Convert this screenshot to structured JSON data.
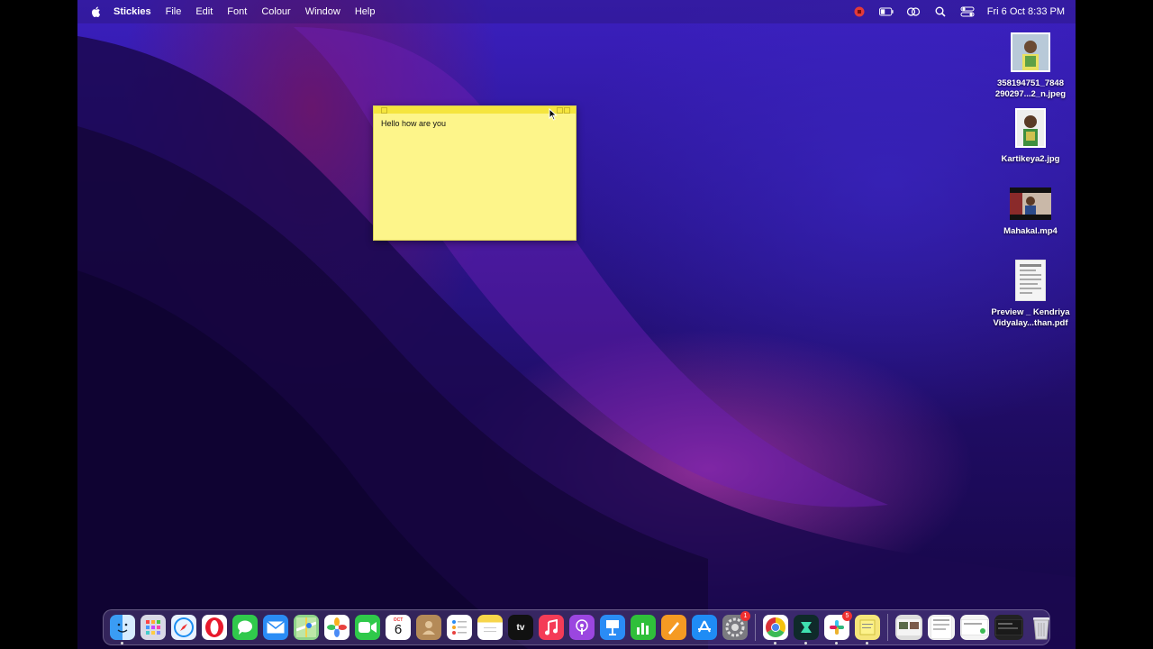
{
  "menubar": {
    "app_name": "Stickies",
    "menus": [
      "File",
      "Edit",
      "Font",
      "Colour",
      "Window",
      "Help"
    ],
    "clock": "Fri 6 Oct  8:33 PM"
  },
  "sticky": {
    "text": "Hello how are you",
    "color": "#fdf58a"
  },
  "desktop_icons": [
    {
      "name_line1": "358194751_7848",
      "name_line2": "290297...2_n.jpeg",
      "kind": "photo"
    },
    {
      "name_line1": "Kartikeya2.jpg",
      "name_line2": "",
      "kind": "photo"
    },
    {
      "name_line1": "Mahakal.mp4",
      "name_line2": "",
      "kind": "video"
    },
    {
      "name_line1": "Preview _ Kendriya",
      "name_line2": "Vidyalay...than.pdf",
      "kind": "pdf"
    }
  ],
  "dock": {
    "calendar_month": "OCT",
    "calendar_day": "6",
    "settings_badge": "1",
    "slack_badge": "5",
    "apps": [
      "finder-icon",
      "launchpad-icon",
      "safari-icon",
      "opera-icon",
      "messages-icon",
      "mail-icon",
      "maps-icon",
      "photos-icon",
      "facetime-icon",
      "calendar-icon",
      "contacts-icon",
      "reminders-icon",
      "notes-icon",
      "appletv-icon",
      "music-icon",
      "podcasts-icon",
      "keynote-icon",
      "numbers-icon",
      "pages-icon",
      "appstore-icon",
      "system-settings-icon",
      "chrome-icon",
      "filmora-icon",
      "slack-icon",
      "stickies-icon",
      "trash-icon"
    ],
    "tv_label": "tv"
  }
}
